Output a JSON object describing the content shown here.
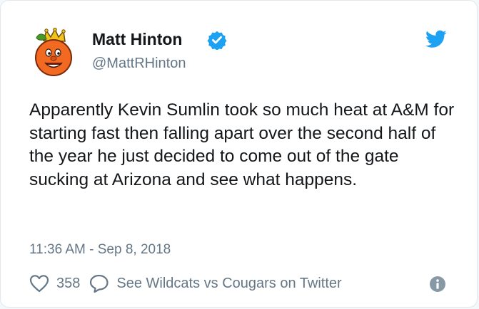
{
  "author": {
    "display_name": "Matt Hinton",
    "handle": "@MattRHinton",
    "verified": true,
    "avatar_icon": "orange-king-mascot-avatar"
  },
  "tweet": {
    "text": "Apparently Kevin Sumlin took so much heat at A&M for starting fast then falling apart over the second half of the year he just decided to come out of the gate sucking at Arizona and see what happens.",
    "timestamp": "11:36 AM - Sep 8, 2018"
  },
  "actions": {
    "like_count": "358",
    "conversation_label": "See Wildcats vs Cougars on Twitter"
  },
  "icons": {
    "brand": "twitter-bird-icon",
    "verified": "verified-badge-icon",
    "like": "heart-icon",
    "reply": "reply-bubble-icon",
    "info": "info-icon"
  },
  "colors": {
    "brand_blue": "#1da1f2",
    "text_primary": "#14171a",
    "text_secondary": "#657786",
    "border": "#e1e8ed"
  }
}
